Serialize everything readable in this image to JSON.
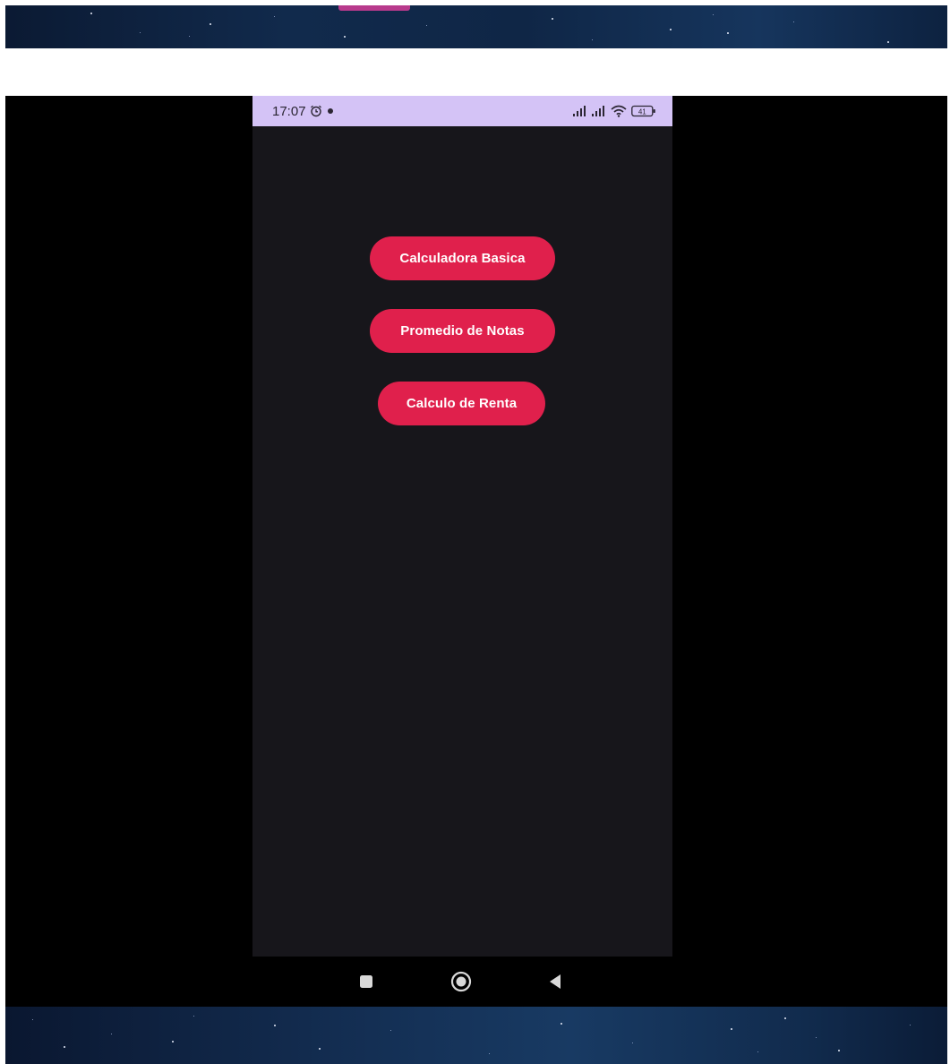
{
  "status_bar": {
    "time": "17:07",
    "left_icons": [
      "alarm-icon",
      "notification-dot-icon"
    ],
    "right_icons": [
      "signal-icon",
      "signal-icon",
      "wifi-icon",
      "battery-icon"
    ],
    "battery_level": "41"
  },
  "buttons": [
    {
      "label": "Calculadora Basica"
    },
    {
      "label": "Promedio de Notas"
    },
    {
      "label": "Calculo de Renta"
    }
  ],
  "nav_bar": {
    "icons": [
      "recent-apps-icon",
      "home-icon",
      "back-icon"
    ]
  },
  "colors": {
    "status_bar_bg": "#d4c3f6",
    "app_bg": "#17161b",
    "button_bg": "#e0204c",
    "button_text": "#ffffff",
    "stage_bg": "#000000"
  }
}
